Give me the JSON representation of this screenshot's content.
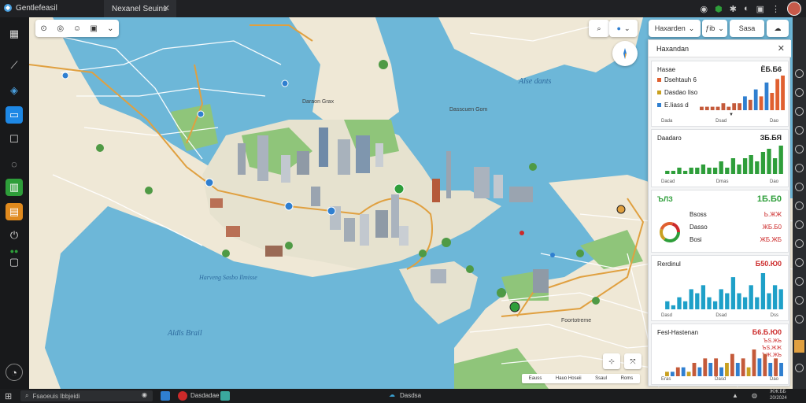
{
  "titlebar": {
    "app_name": "Gentlefeasil",
    "tab_title": "Nexanel Seuins",
    "close": "✕",
    "right_icons": [
      "github-icon",
      "shield-icon",
      "puzzle-icon",
      "share-icon",
      "window-icon",
      "more-icon"
    ]
  },
  "map_toolbar": {
    "dropdown_caret": "⌄"
  },
  "top_controls": {
    "search_label": "",
    "layers_label": "",
    "hazard_select": "Haxarden",
    "count_select": "ƒib",
    "sasa_button": "Sasa",
    "caret": "⌄"
  },
  "map_labels": {
    "sea_north": "Alse dants",
    "bay_center": "Daraon Grax",
    "bay_right": "Dasscuen Gom",
    "waterway": "Harveng Sasbo Ilmisse",
    "sea_south": "Aldls Brail",
    "district_east": "Foortotreme"
  },
  "side_panel": {
    "title": "Haxandan",
    "close": "✕",
    "cards": [
      {
        "title": "Hasae",
        "value": "ЁБ.Б6",
        "rows": [
          {
            "label": "Dsehtauh 6",
            "color": "#e06030"
          },
          {
            "label": "Dasdao Iiso",
            "color": "#c9a020"
          },
          {
            "label": "E.Iiass d",
            "color": "#2f7fd0"
          }
        ],
        "foot": [
          "Dada",
          "Dsad",
          "Dao"
        ],
        "marker": "▼"
      },
      {
        "title": "Daadaro",
        "value": "ЗБ.БЯ",
        "foot": [
          "Dacad",
          "Dmas",
          "Dao"
        ]
      },
      {
        "title": "ЪЛЗ",
        "value": "1Б.Б0",
        "value_color": "#2e9e3a",
        "rows": [
          {
            "label": "Bsoss",
            "value": "Ь.ЖЖ",
            "color": "#cc2a2a"
          },
          {
            "label": "Dasso",
            "value": "ЖБ.Б0",
            "color": "#cc2a2a"
          },
          {
            "label": "Bosi",
            "value": "ЖБ.ЖБ",
            "color": "#cc2a2a"
          }
        ]
      },
      {
        "title": "Rerdinul",
        "value": "Б50.Ю0",
        "value_color": "#cc2a2a",
        "foot": [
          "Dasd",
          "Dsad",
          "Dss"
        ]
      },
      {
        "title": "Fesl-Hastenan",
        "value": "Б6.Б.Ю0",
        "value_color": "#cc2a2a",
        "rows": [
          {
            "label": "",
            "value": "ЪS.ЖЬ",
            "color": "#cc2a2a"
          },
          {
            "label": "",
            "value": "ЪS.ЖЖ",
            "color": "#cc2a2a"
          },
          {
            "label": "",
            "value": "ЪЖ.ЖЬ",
            "color": "#cc2a2a"
          }
        ],
        "foot": [
          "Eras",
          "Dasd",
          "Dao"
        ]
      }
    ],
    "donut": {
      "segments": [
        0.35,
        0.2,
        0.25,
        0.2
      ],
      "colors": [
        "#2e9e3a",
        "#c9a020",
        "#e06030",
        "#cc2a2a"
      ]
    }
  },
  "legend": {
    "items": [
      "Eauss",
      "Hauo Hoseii",
      "Ssaul",
      "Roms"
    ]
  },
  "taskbar": {
    "search_placeholder": "Fsaoeuis Ibbjeidi",
    "app_label": "Dasdadae",
    "app_label2": "Dasdsa",
    "time": "ЖЖ:ББ",
    "date": "20/2024"
  },
  "charts": {
    "card1": [
      1,
      1,
      1,
      1,
      2,
      1,
      2,
      2,
      4,
      3,
      6,
      4,
      8,
      5,
      9,
      10
    ],
    "card1_colors": [
      "#c45a3a",
      "#c45a3a",
      "#c45a3a",
      "#c45a3a",
      "#c45a3a",
      "#c45a3a",
      "#c45a3a",
      "#c45a3a",
      "#2f7fd0",
      "#c45a3a",
      "#2f7fd0",
      "#e06030",
      "#2f7fd0",
      "#e06030",
      "#e06030",
      "#e06030"
    ],
    "card2": [
      1,
      1,
      2,
      1,
      2,
      2,
      3,
      2,
      2,
      4,
      2,
      5,
      3,
      5,
      6,
      4,
      7,
      8,
      5,
      9
    ],
    "card4": [
      2,
      1,
      3,
      2,
      5,
      4,
      6,
      3,
      2,
      5,
      4,
      8,
      4,
      3,
      6,
      3,
      9,
      4,
      6,
      5
    ],
    "card5": [
      1,
      1,
      2,
      2,
      1,
      3,
      2,
      4,
      3,
      4,
      2,
      3,
      5,
      3,
      4,
      2,
      6,
      4,
      5,
      3,
      4,
      3
    ],
    "card5_colors": [
      "#c9a020",
      "#2f7fd0",
      "#c45a3a",
      "#2f7fd0",
      "#c9a020",
      "#c45a3a",
      "#2f7fd0",
      "#c45a3a",
      "#2f7fd0",
      "#c45a3a",
      "#2f7fd0",
      "#c9a020",
      "#c45a3a",
      "#2f7fd0",
      "#c45a3a",
      "#c9a020",
      "#c45a3a",
      "#2f7fd0",
      "#c45a3a",
      "#2f7fd0",
      "#c45a3a",
      "#2f7fd0"
    ]
  }
}
